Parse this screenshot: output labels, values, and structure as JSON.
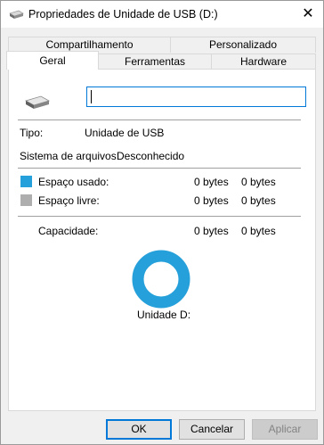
{
  "window": {
    "title": "Propriedades de Unidade de USB (D:)",
    "close_glyph": "✕"
  },
  "tabs": {
    "row1": [
      {
        "label": "Compartilhamento"
      },
      {
        "label": "Personalizado"
      }
    ],
    "row2": [
      {
        "label": "Geral",
        "active": true
      },
      {
        "label": "Ferramentas"
      },
      {
        "label": "Hardware"
      }
    ]
  },
  "general": {
    "drive_icon": "usb-drive-icon",
    "name_value": "",
    "type_label": "Tipo:",
    "type_value": "Unidade de USB",
    "fs_label": "Sistema de arquivos:",
    "fs_value": "Desconhecido",
    "used_label": "Espaço usado:",
    "used_value_a": "0 bytes",
    "used_value_b": "0 bytes",
    "free_label": "Espaço livre:",
    "free_value_a": "0 bytes",
    "free_value_b": "0 bytes",
    "capacity_label": "Capacidade:",
    "capacity_value_a": "0 bytes",
    "capacity_value_b": "0 bytes",
    "drive_caption": "Unidade D:"
  },
  "colors": {
    "used": "#26a0da",
    "free": "#aeaeae",
    "donut": "#26a0da",
    "accent": "#0078d7"
  },
  "buttons": {
    "ok": "OK",
    "cancel": "Cancelar",
    "apply": "Aplicar"
  }
}
